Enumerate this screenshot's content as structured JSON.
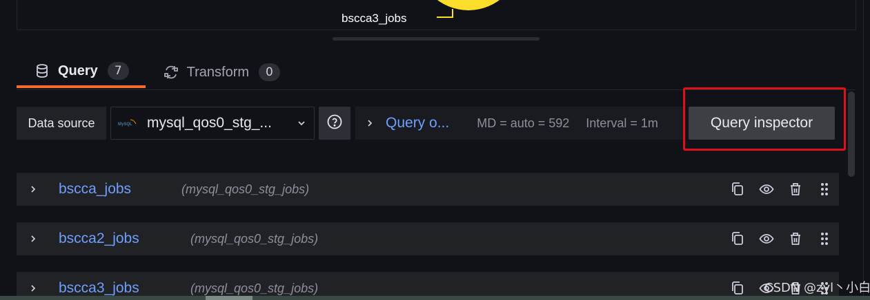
{
  "legend": {
    "label": "bscca3_jobs",
    "color": "#fade2a"
  },
  "tabs": [
    {
      "label": "Query",
      "count": "7",
      "icon": "database-icon",
      "active": true
    },
    {
      "label": "Transform",
      "count": "0",
      "icon": "transform-icon",
      "active": false
    }
  ],
  "toolbar": {
    "data_source_label": "Data source",
    "data_source_value": "mysql_qos0_stg_...",
    "data_source_logo": "mysql-logo",
    "help_icon": "question-circle-icon",
    "query_options_label": "Query o...",
    "md_text": "MD = auto = 592",
    "interval_text": "Interval = 1m",
    "query_inspector_label": "Query inspector"
  },
  "queries": [
    {
      "name": "bscca_jobs",
      "datasource": "(mysql_qos0_stg_jobs)"
    },
    {
      "name": "bscca2_jobs",
      "datasource": "(mysql_qos0_stg_jobs)"
    },
    {
      "name": "bscca3_jobs",
      "datasource": "(mysql_qos0_stg_jobs)"
    }
  ],
  "row_action_icons": [
    "copy-icon",
    "eye-icon",
    "trash-icon",
    "drag-handle-icon"
  ],
  "watermark": "CSDN @zyl丶小白",
  "colors": {
    "accent_blue": "#6e9fff",
    "active_tab_underline": "#f26d2b",
    "highlight_red": "#e0101a",
    "background": "#111217"
  }
}
